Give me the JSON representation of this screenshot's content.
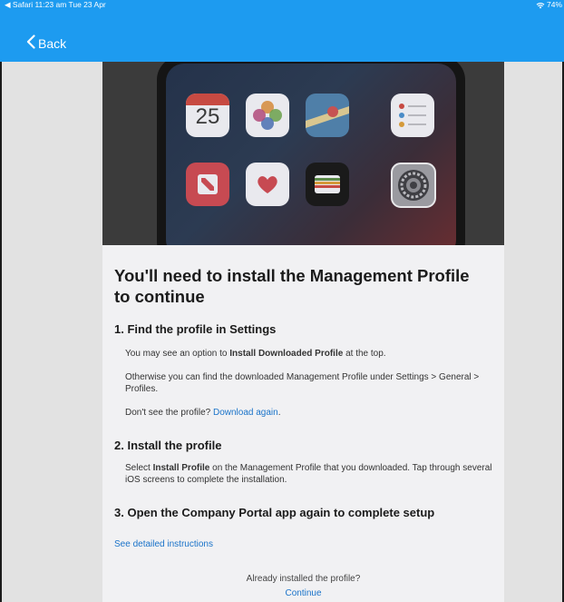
{
  "status_bar": {
    "left_text": "◀ Safari  11:23 am  Tue 23 Apr",
    "battery": "74%"
  },
  "nav": {
    "back_label": "Back"
  },
  "hero_image": {
    "calendar_day": "25"
  },
  "content": {
    "title": "You'll need to install the Management Profile to continue",
    "step1": {
      "heading": "1. Find the profile in Settings",
      "line1_prefix": "You may see an option to ",
      "line1_bold": "Install Downloaded Profile",
      "line1_suffix": " at the top.",
      "line2": "Otherwise you can find the downloaded Management Profile under Settings > General > Profiles.",
      "line3_prefix": "Don't see the profile? ",
      "line3_link": "Download again",
      "line3_suffix": "."
    },
    "step2": {
      "heading": "2. Install the profile",
      "text_prefix": "Select ",
      "text_bold": "Install Profile",
      "text_suffix": " on the Management Profile that you downloaded. Tap through several iOS screens to complete the installation."
    },
    "step3": {
      "heading": "3. Open the Company Portal app again to complete setup"
    },
    "detailed_link": "See detailed instructions",
    "already_installed": "Already installed the profile?",
    "continue_link": "Continue"
  },
  "colors": {
    "accent": "#1d9bf0",
    "link": "#1a73c9",
    "content_bg": "#f1f1f3",
    "side_bg": "#e2e2e2"
  }
}
